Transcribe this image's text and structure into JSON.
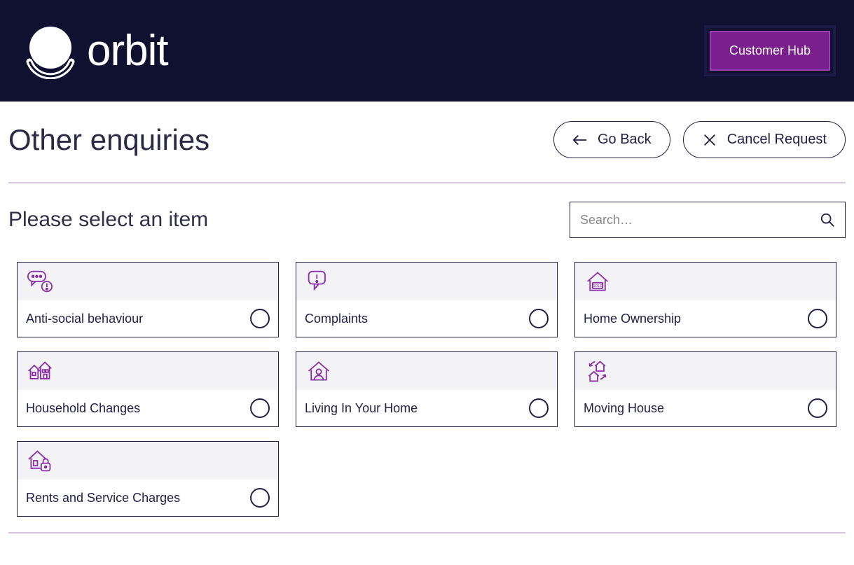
{
  "header": {
    "logo_text": "orbit",
    "hub_button": "Customer Hub"
  },
  "page": {
    "title": "Other enquiries",
    "go_back": "Go Back",
    "cancel": "Cancel Request",
    "subtitle": "Please select an item",
    "search_placeholder": "Search…"
  },
  "cards": [
    {
      "label": "Anti-social behaviour",
      "icon": "speech-alert"
    },
    {
      "label": "Complaints",
      "icon": "chat-warning"
    },
    {
      "label": "Home Ownership",
      "icon": "house-sold"
    },
    {
      "label": "Household Changes",
      "icon": "houses"
    },
    {
      "label": "Living In Your Home",
      "icon": "house-person"
    },
    {
      "label": "Moving House",
      "icon": "house-swap"
    },
    {
      "label": "Rents and Service Charges",
      "icon": "house-lock"
    }
  ]
}
